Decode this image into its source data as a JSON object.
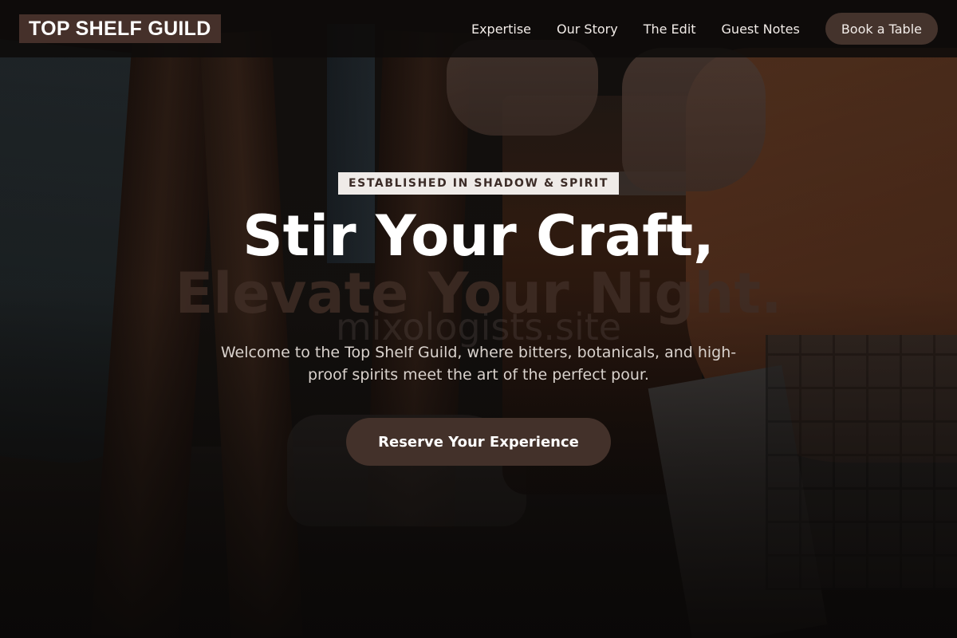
{
  "nav": {
    "logo": "TOP SHELF GUILD",
    "links": [
      {
        "label": "Expertise"
      },
      {
        "label": "Our Story"
      },
      {
        "label": "The Edit"
      },
      {
        "label": "Guest Notes"
      }
    ],
    "cta_label": "Book a Table"
  },
  "hero": {
    "eyebrow": "ESTABLISHED IN SHADOW & SPIRIT",
    "headline_line1": "Stir Your Craft,",
    "headline_line2": "Elevate Your Night.",
    "watermark": "mixologists.site",
    "subtitle": "Welcome to the Top Shelf Guild, where bitters, botanicals, and high-proof spirits meet the art of the perfect pour.",
    "cta_label": "Reserve Your Experience"
  },
  "colors": {
    "accent_brown": "#44332c",
    "nav_background": "#0e0b0a",
    "eyebrow_background": "#efebe8",
    "text_light": "#f2ece8"
  }
}
